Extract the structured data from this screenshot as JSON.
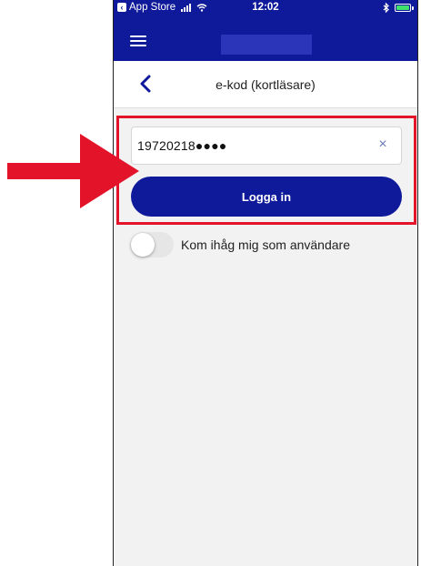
{
  "status_bar": {
    "back_app_label": "App Store",
    "time": "12:02"
  },
  "header": {
    "title": "e-kod (kortläsare)"
  },
  "login": {
    "input_value": "19720218●●●●",
    "clear_symbol": "×",
    "button_label": "Logga in"
  },
  "remember": {
    "label": "Kom ihåg mig som användare",
    "enabled": false
  },
  "colors": {
    "brand": "#0f1a9a",
    "annotation": "#e3142a",
    "background": "#f2f2f2"
  },
  "icons": [
    "app-back-icon",
    "signal-icon",
    "wifi-icon",
    "bluetooth-icon",
    "battery-icon",
    "menu-icon",
    "back-chevron-icon",
    "clear-icon"
  ]
}
